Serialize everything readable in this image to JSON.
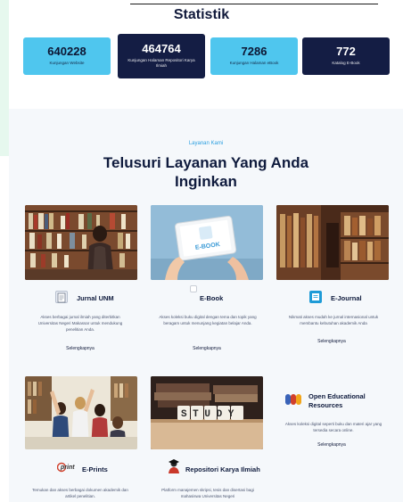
{
  "header": {
    "title": "Statistik"
  },
  "stats": [
    {
      "value": "640228",
      "label": "Kunjungan Website"
    },
    {
      "value": "464764",
      "label": "Kunjungan Halaman Repositori Karya Ilmiah"
    },
    {
      "value": "7286",
      "label": "Kunjungan Halaman eBook"
    },
    {
      "value": "772",
      "label": "Katalog E-Book"
    }
  ],
  "services": {
    "eyebrow": "Layanan Kami",
    "title": "Telusuri Layanan Yang Anda Inginkan",
    "cards": [
      {
        "name": "Jurnal UNM",
        "desc": "Akses berbagai jurnal ilmiah yang diterbitkan Universitas Negeri Makassar untuk mendukung penelitian Anda.",
        "more": "Selengkapnya"
      },
      {
        "name": "E-Book",
        "desc": "Akses koleksi buku digital dengan tema dan topik yang beragam untuk menunjang kegiatan belajar Anda.",
        "more": "Selengkapnya",
        "image_text": "E-BOOK"
      },
      {
        "name": "E-Journal",
        "desc": "Nikmati akses mudah ke jurnal internasional untuk membantu kebutuhan akademik Anda",
        "more": "Selengkapnya"
      },
      {
        "name": "E-Prints",
        "desc": "Temukan dan akses berbagai dokumen akademik dan artikel penelitian.",
        "more": "",
        "icon_text": "print"
      },
      {
        "name": "Repositori Karya Ilmiah",
        "desc": "Platform manajemen skripsi, tesis dan disertasi bagi mahasiswa Universitas Negeri",
        "more": "",
        "image_text": "STUDY"
      },
      {
        "name": "Open Educational Resources",
        "desc": "Akses koleksi digital seperti buku dan materi ajar yang tersedia secara online.",
        "more": "Selengkapnya"
      }
    ]
  },
  "colors": {
    "light_card": "#4fc6ee",
    "dark_card": "#141d44",
    "accent": "#2b9fe0",
    "section_bg": "#f5f8fb"
  }
}
